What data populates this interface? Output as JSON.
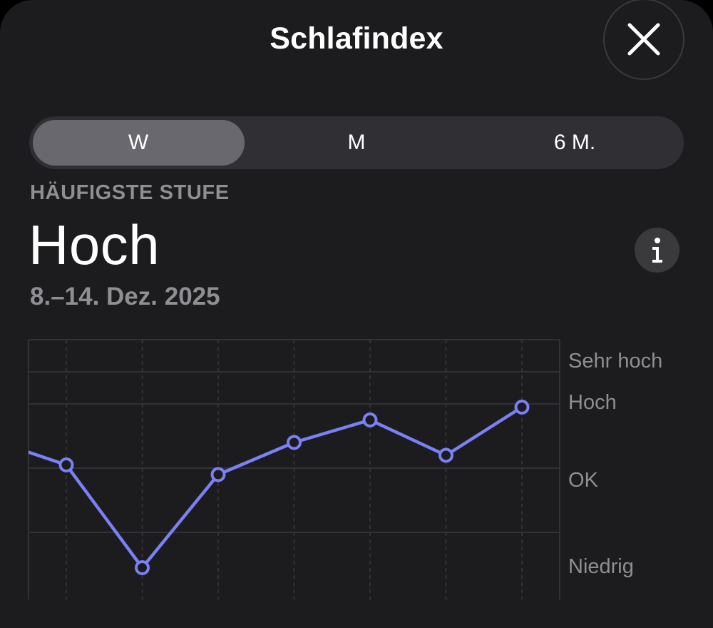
{
  "header": {
    "title": "Schlafindex",
    "close_icon": "close-icon"
  },
  "segments": [
    {
      "label": "W",
      "active": true
    },
    {
      "label": "M",
      "active": false
    },
    {
      "label": "6 M.",
      "active": false
    }
  ],
  "summary": {
    "eyebrow": "HÄUFIGSTE STUFE",
    "value": "Hoch",
    "date_range": "8.–14. Dez. 2025",
    "info_icon": "info-icon"
  },
  "colors": {
    "background": "#1c1c1e",
    "line": "#7a80f5",
    "secondary_text": "#8e8e93",
    "grid": "#3a3a3c"
  },
  "chart_data": {
    "type": "line",
    "y_categories": [
      "Niedrig",
      "OK",
      "Hoch",
      "Sehr hoch"
    ],
    "ylim": [
      0,
      4
    ],
    "y_label_values": [
      0.75,
      1.75,
      2.75,
      3.25
    ],
    "series": [
      {
        "values": [
          2.45,
          2.05,
          0.45,
          1.9,
          2.4,
          2.75,
          2.2,
          2.95
        ]
      }
    ],
    "grid": true
  }
}
